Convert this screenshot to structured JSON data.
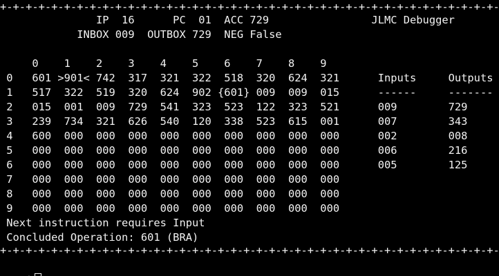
{
  "border": "+-+-+-+-+-+-+-+-+-+-+-+-+-+-+-+-+-+-+-+-+-+-+-+-+-+-+-+-+-+-+-+-+-+-+-+-+-+-+-+-+-+-+-+-+-+-+-+-+-+-+-+-+-+-+-+-+-+-+-+-+-+-+-+-+-+-+-+-+-+-+-+-+",
  "header": {
    "line1": "               IP  16      PC  01  ACC 729                JLMC Debugger",
    "line2": "            INBOX 009  OUTBOX 729  NEG False"
  },
  "memory": {
    "column_header": "     0    1    2    3    4    5    6    7    8    9",
    "rows": [
      " 0   601 >901< 742  317  321  322  518  320  624  321      Inputs     Outputs",
      " 1   517  322  519  320  624  902 {601} 009  009  015      ------     -------",
      " 2   015  001  009  729  541  323  523  122  323  521      009        729",
      " 3   239  734  321  626  540  120  338  523  615  001      007        343",
      " 4   600  000  000  000  000  000  000  000  000  000      002        008",
      " 5   000  000  000  000  000  000  000  000  000  000      006        216",
      " 6   000  000  000  000  000  000  000  000  000  000      005        125",
      " 7   000  000  000  000  000  000  000  000  000  000",
      " 8   000  000  000  000  000  000  000  000  000  000",
      " 9   000  000  000  000  000  000  000  000  000  000"
    ]
  },
  "status": {
    "next_instruction": " Next instruction requires Input",
    "concluded": " Concluded Operation: 601 (BRA)"
  },
  "prompt": {
    "symbol": "$"
  },
  "colors": {
    "background": "#000000",
    "foreground": "#f2f2f2"
  }
}
